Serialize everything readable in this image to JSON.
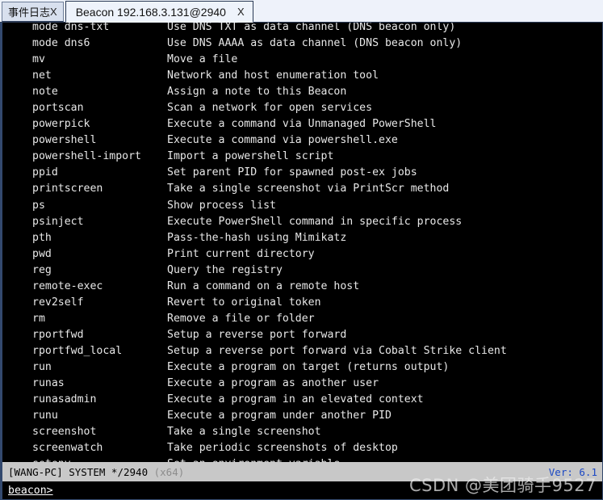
{
  "window": {
    "tabs": [
      {
        "label": "事件日志",
        "close_label": "X",
        "active": false,
        "name": "tab-event-log"
      },
      {
        "label": "Beacon 192.168.3.131@2940",
        "close_label": "X",
        "active": true,
        "name": "tab-beacon"
      }
    ]
  },
  "terminal": {
    "lines": [
      {
        "command": "mode dns-txt",
        "description": "Use DNS TXT as data channel (DNS beacon only)"
      },
      {
        "command": "mode dns6",
        "description": "Use DNS AAAA as data channel (DNS beacon only)"
      },
      {
        "command": "mv",
        "description": "Move a file"
      },
      {
        "command": "net",
        "description": "Network and host enumeration tool"
      },
      {
        "command": "note",
        "description": "Assign a note to this Beacon"
      },
      {
        "command": "portscan",
        "description": "Scan a network for open services"
      },
      {
        "command": "powerpick",
        "description": "Execute a command via Unmanaged PowerShell"
      },
      {
        "command": "powershell",
        "description": "Execute a command via powershell.exe"
      },
      {
        "command": "powershell-import",
        "description": "Import a powershell script"
      },
      {
        "command": "ppid",
        "description": "Set parent PID for spawned post-ex jobs"
      },
      {
        "command": "printscreen",
        "description": "Take a single screenshot via PrintScr method"
      },
      {
        "command": "ps",
        "description": "Show process list"
      },
      {
        "command": "psinject",
        "description": "Execute PowerShell command in specific process"
      },
      {
        "command": "pth",
        "description": "Pass-the-hash using Mimikatz"
      },
      {
        "command": "pwd",
        "description": "Print current directory"
      },
      {
        "command": "reg",
        "description": "Query the registry"
      },
      {
        "command": "remote-exec",
        "description": "Run a command on a remote host"
      },
      {
        "command": "rev2self",
        "description": "Revert to original token"
      },
      {
        "command": "rm",
        "description": "Remove a file or folder"
      },
      {
        "command": "rportfwd",
        "description": "Setup a reverse port forward"
      },
      {
        "command": "rportfwd_local",
        "description": "Setup a reverse port forward via Cobalt Strike client"
      },
      {
        "command": "run",
        "description": "Execute a program on target (returns output)"
      },
      {
        "command": "runas",
        "description": "Execute a program as another user"
      },
      {
        "command": "runasadmin",
        "description": "Execute a program in an elevated context"
      },
      {
        "command": "runu",
        "description": "Execute a program under another PID"
      },
      {
        "command": "screenshot",
        "description": "Take a single screenshot"
      },
      {
        "command": "screenwatch",
        "description": "Take periodic screenshots of desktop"
      },
      {
        "command": "setenv",
        "description": "Set an environment variable"
      }
    ]
  },
  "status": {
    "host": "[WANG-PC]",
    "user": "SYSTEM *",
    "pid": "/2940",
    "arch": "(x64)",
    "left_text": "[WANG-PC] SYSTEM */2940 ",
    "version": "Ver: 6.1"
  },
  "prompt": {
    "label": "beacon>",
    "value": "",
    "placeholder": ""
  },
  "watermark": {
    "text": "CSDN @美团骑手9527"
  },
  "colors": {
    "terminal_bg": "#000000",
    "terminal_fg": "#e8e8e8",
    "statusbar_bg": "#c8c8c8",
    "version_fg": "#1a47c4",
    "arch_fg": "#8c8c8c",
    "border": "#33496e",
    "tab_active_bg": "#eef3fb",
    "tab_inactive_bg": "#d8e0ee"
  }
}
